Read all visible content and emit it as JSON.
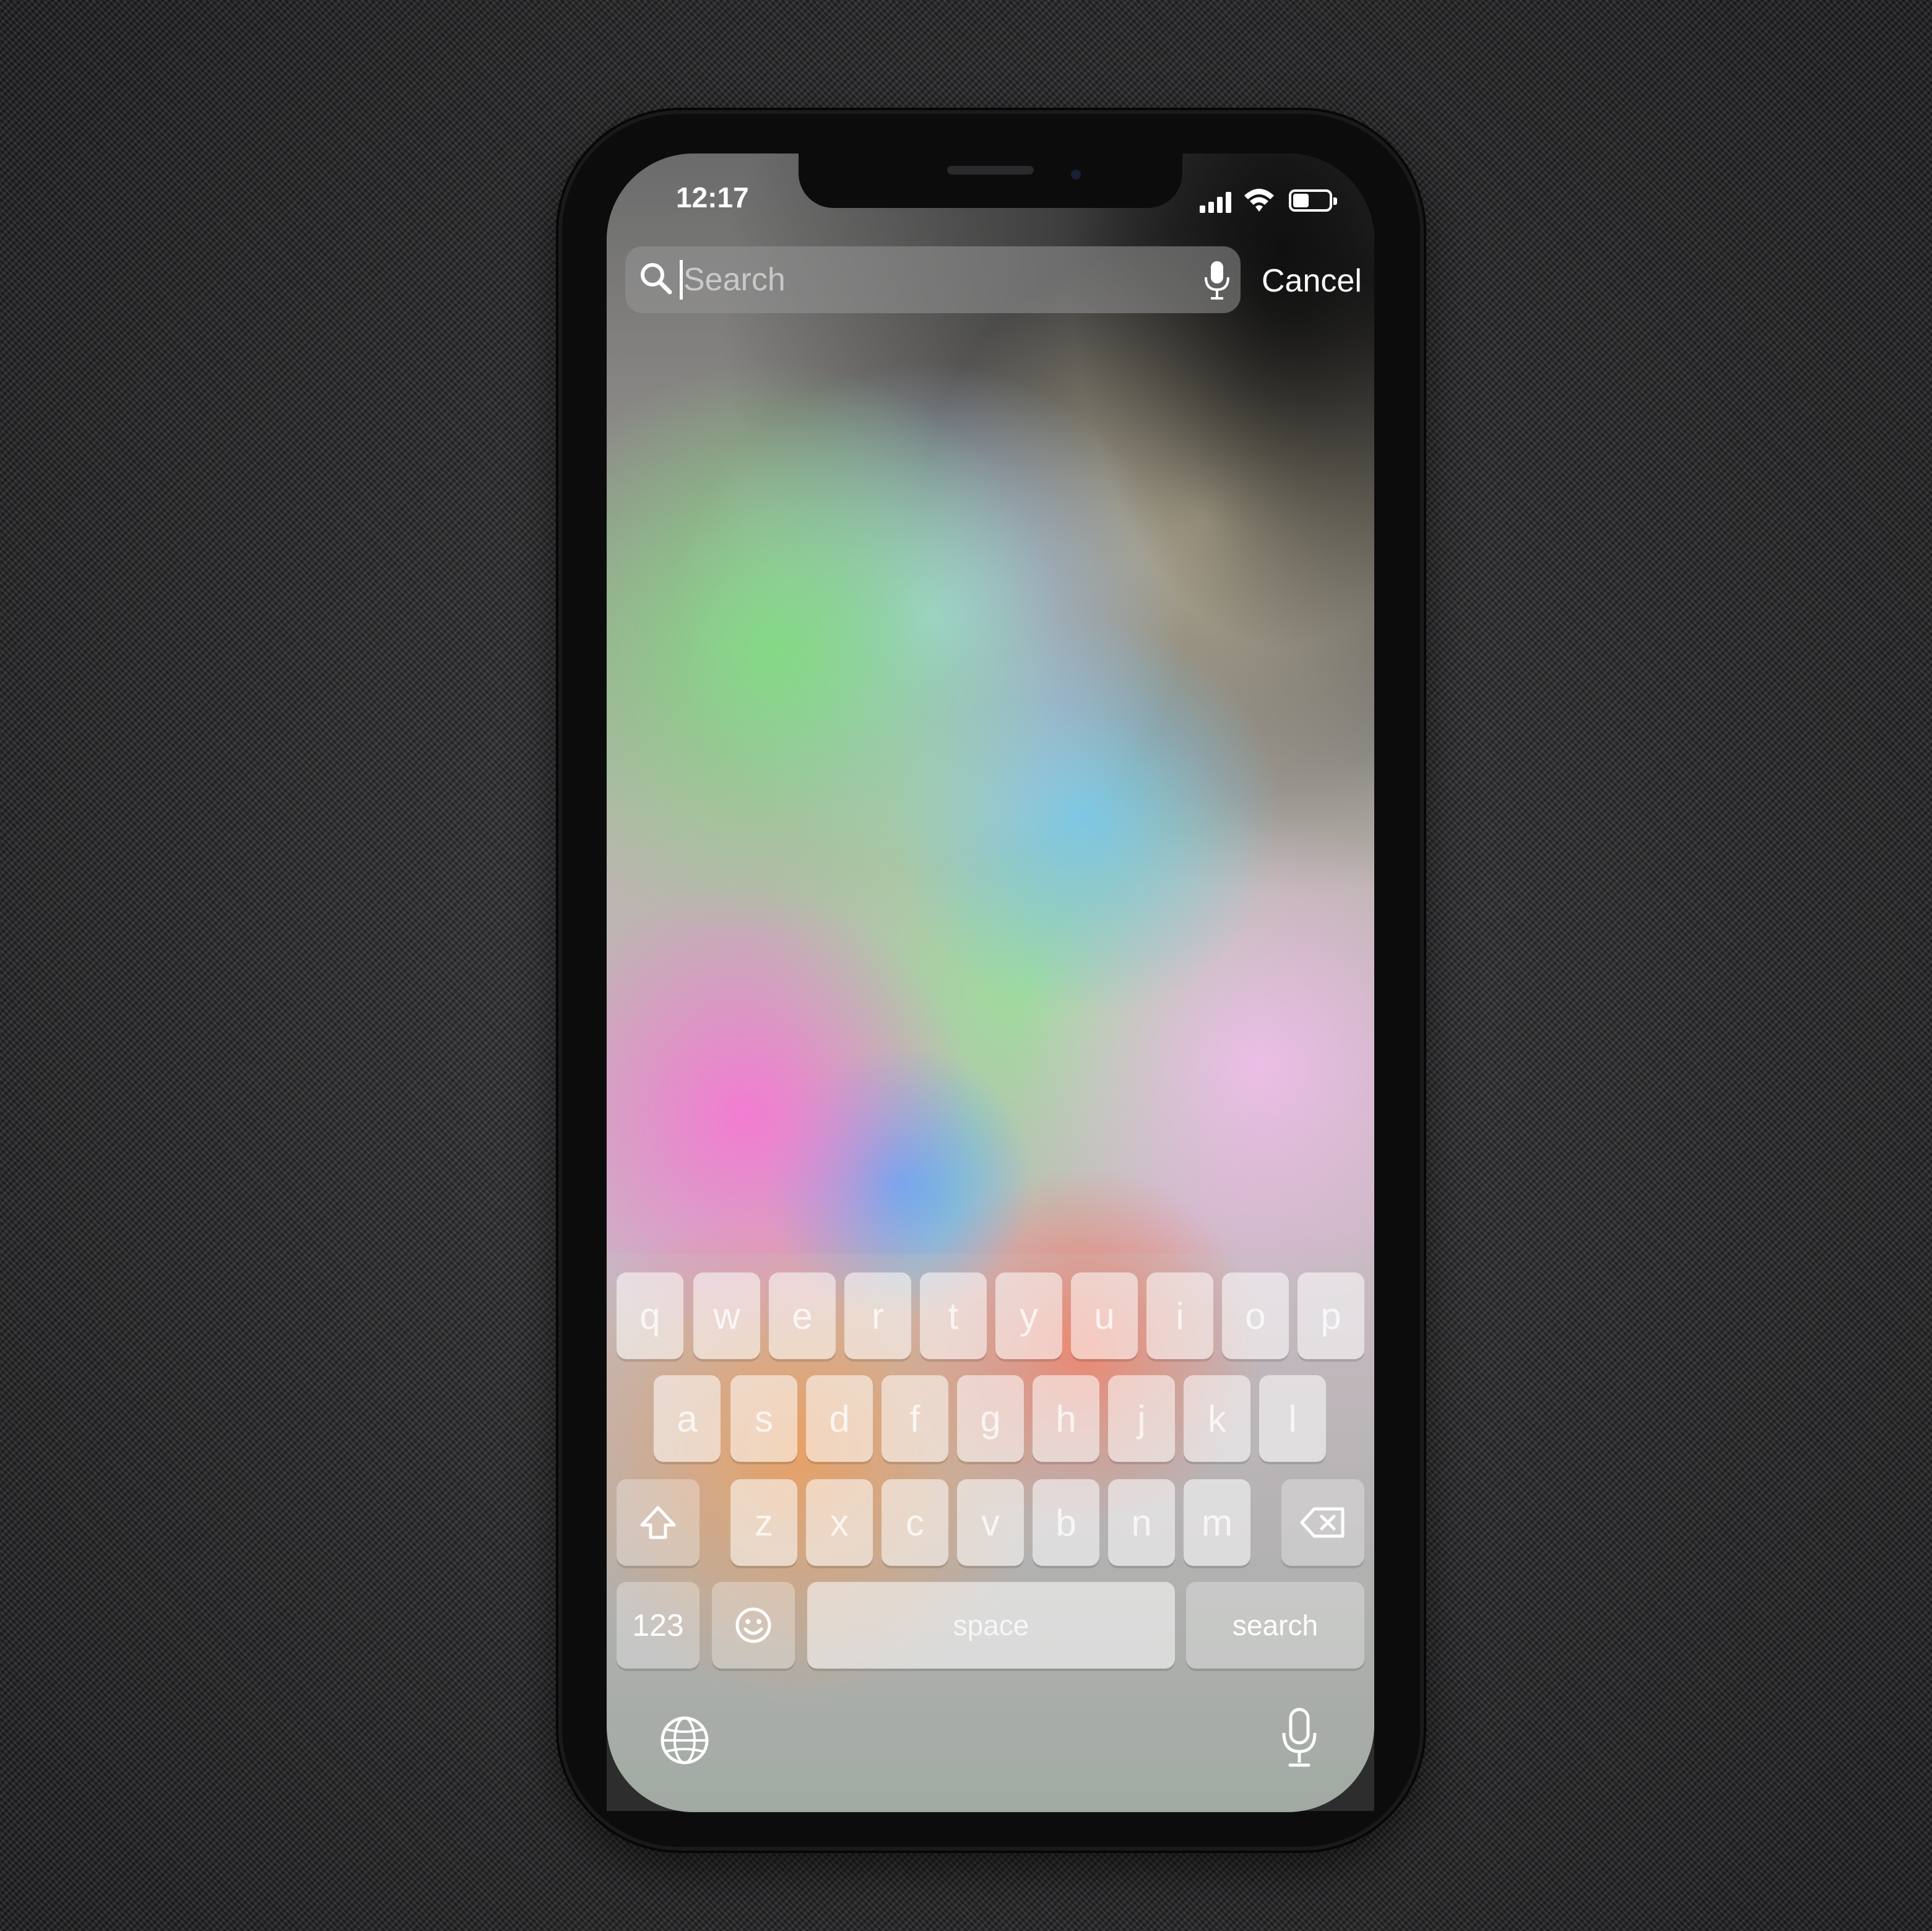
{
  "status_bar": {
    "time": "12:17",
    "battery_level": 0.45
  },
  "search": {
    "placeholder": "Search",
    "value": "",
    "cancel_label": "Cancel"
  },
  "keyboard": {
    "row1": [
      "q",
      "w",
      "e",
      "r",
      "t",
      "y",
      "u",
      "i",
      "o",
      "p"
    ],
    "row2": [
      "a",
      "s",
      "d",
      "f",
      "g",
      "h",
      "j",
      "k",
      "l"
    ],
    "row3": [
      "z",
      "x",
      "c",
      "v",
      "b",
      "n",
      "m"
    ],
    "numbers_label": "123",
    "space_label": "space",
    "search_label": "search"
  },
  "icons": {
    "search": "search-icon",
    "dictation": "microphone-icon",
    "shift": "shift-icon",
    "delete": "delete-icon",
    "emoji": "emoji-icon",
    "globe": "globe-icon"
  }
}
